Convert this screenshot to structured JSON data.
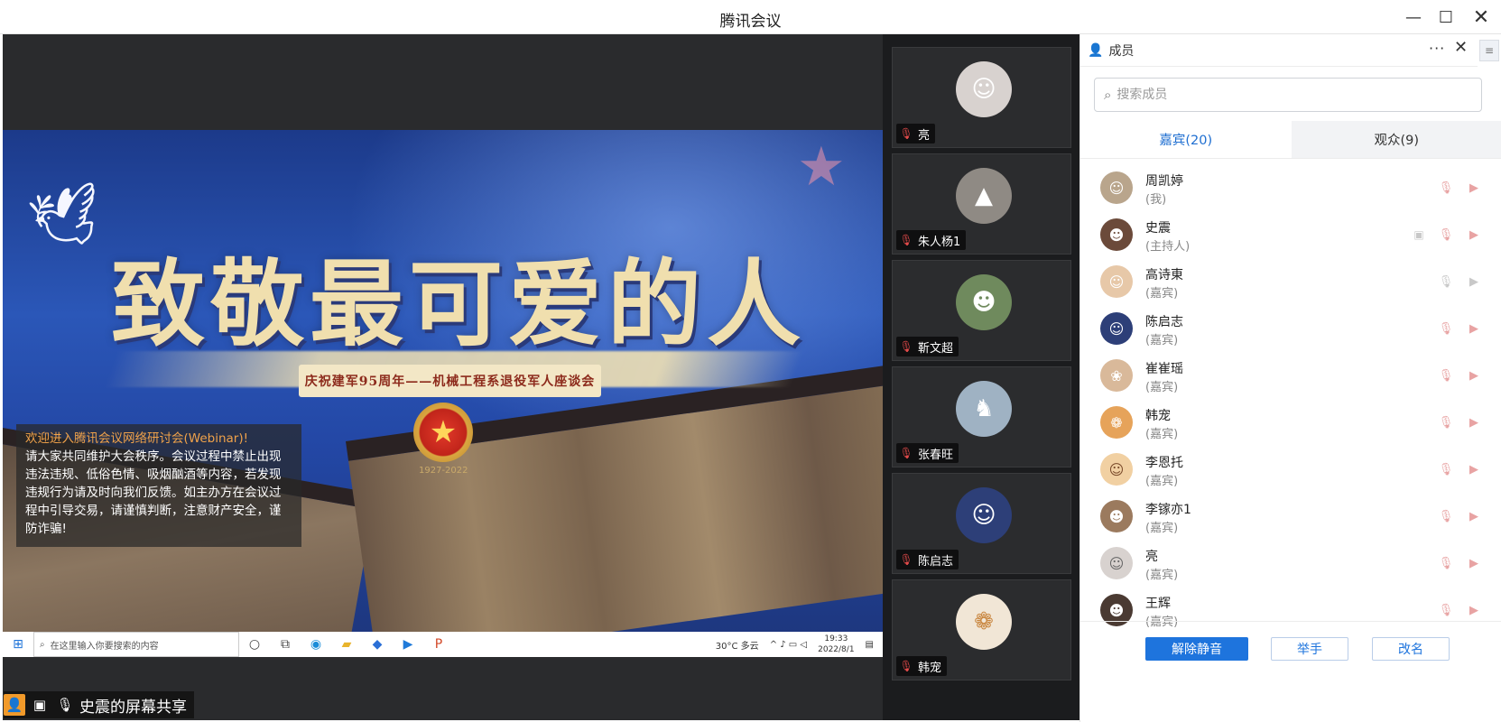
{
  "window": {
    "title": "腾讯会议",
    "minimize": "—",
    "maximize": "☐",
    "close": "✕"
  },
  "share": {
    "headline": "致敬最可爱的人",
    "ribbon": "庆祝建军95周年——机械工程系退役军人座谈会",
    "years": "1927-2022",
    "taskbar_search_placeholder": "在这里输入你要搜索的内容",
    "weather": "30°C 多云",
    "time": "19:33",
    "date": "2022/8/1"
  },
  "notice": {
    "title": "欢迎进入腾讯会议网络研讨会(Webinar)!",
    "body": "请大家共同维护大会秩序。会议过程中禁止出现违法违规、低俗色情、吸烟酗酒等内容，若发现违规行为请及时向我们反馈。如主办方在会议过程中引导交易，请谨慎判断，注意财产安全，谨防诈骗!"
  },
  "share_label": "史震的屏幕共享",
  "video_tiles": [
    {
      "name": "亮",
      "avatar_color": "#d8d2cf"
    },
    {
      "name": "朱人杨1",
      "avatar_color": "#8f8a84"
    },
    {
      "name": "靳文超",
      "avatar_color": "#6f8a5d"
    },
    {
      "name": "张春旺",
      "avatar_color": "#9fb2c3"
    },
    {
      "name": "陈启志",
      "avatar_color": "#2d3f78"
    },
    {
      "name": "韩宠",
      "avatar_color": "#f1e6d6"
    }
  ],
  "panel": {
    "title": "成员",
    "more": "···",
    "close": "✕",
    "search_placeholder": "搜索成员",
    "tabs": {
      "guests": "嘉宾(20)",
      "audience": "观众(9)"
    },
    "members": [
      {
        "name": "周凯婷",
        "role": "(我)",
        "avatar_color": "#b9a58c"
      },
      {
        "name": "史震",
        "role": "(主持人)",
        "avatar_color": "#6b4a3a"
      },
      {
        "name": "高诗東",
        "role": "(嘉宾)",
        "avatar_color": "#e7c8a8"
      },
      {
        "name": "陈启志",
        "role": "(嘉宾)",
        "avatar_color": "#2d3f78"
      },
      {
        "name": "崔崔瑶",
        "role": "(嘉宾)",
        "avatar_color": "#d9b99a"
      },
      {
        "name": "韩宠",
        "role": "(嘉宾)",
        "avatar_color": "#e6a35a"
      },
      {
        "name": "李恩托",
        "role": "(嘉宾)",
        "avatar_color": "#f1d0a2"
      },
      {
        "name": "李镓亦1",
        "role": "(嘉宾)",
        "avatar_color": "#9b7a5e"
      },
      {
        "name": "亮",
        "role": "(嘉宾)",
        "avatar_color": "#d8d2cf"
      },
      {
        "name": "王辉",
        "role": "(嘉宾)",
        "avatar_color": "#4a3a32"
      }
    ],
    "buttons": {
      "unmute": "解除静音",
      "raise_hand": "举手",
      "rename": "改名"
    }
  },
  "colors": {
    "accent": "#1e74dd",
    "notice_highlight": "#f0a24a",
    "mic_off": "#e24a4a"
  }
}
